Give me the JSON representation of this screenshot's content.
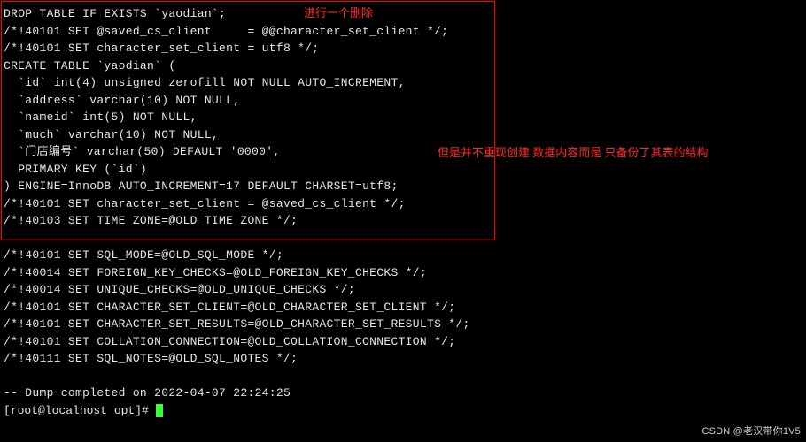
{
  "annotations": {
    "top": "进行一个删除",
    "side": "但是并不重现创建 数据内容而是 只备份了其表的结构"
  },
  "box_lines": [
    "DROP TABLE IF EXISTS `yaodian`;",
    "/*!40101 SET @saved_cs_client     = @@character_set_client */;",
    "/*!40101 SET character_set_client = utf8 */;",
    "CREATE TABLE `yaodian` (",
    "  `id` int(4) unsigned zerofill NOT NULL AUTO_INCREMENT,",
    "  `address` varchar(10) NOT NULL,",
    "  `nameid` int(5) NOT NULL,",
    "  `much` varchar(10) NOT NULL,",
    "  `门店编号` varchar(50) DEFAULT '0000',",
    "  PRIMARY KEY (`id`)",
    ") ENGINE=InnoDB AUTO_INCREMENT=17 DEFAULT CHARSET=utf8;",
    "/*!40101 SET character_set_client = @saved_cs_client */;",
    "/*!40103 SET TIME_ZONE=@OLD_TIME_ZONE */;"
  ],
  "rest_lines": [
    "",
    "/*!40101 SET SQL_MODE=@OLD_SQL_MODE */;",
    "/*!40014 SET FOREIGN_KEY_CHECKS=@OLD_FOREIGN_KEY_CHECKS */;",
    "/*!40014 SET UNIQUE_CHECKS=@OLD_UNIQUE_CHECKS */;",
    "/*!40101 SET CHARACTER_SET_CLIENT=@OLD_CHARACTER_SET_CLIENT */;",
    "/*!40101 SET CHARACTER_SET_RESULTS=@OLD_CHARACTER_SET_RESULTS */;",
    "/*!40101 SET COLLATION_CONNECTION=@OLD_COLLATION_CONNECTION */;",
    "/*!40111 SET SQL_NOTES=@OLD_SQL_NOTES */;",
    "",
    "-- Dump completed on 2022-04-07 22:24:25"
  ],
  "prompt": "[root@localhost opt]# ",
  "watermark": "CSDN @老汉带你1V5"
}
